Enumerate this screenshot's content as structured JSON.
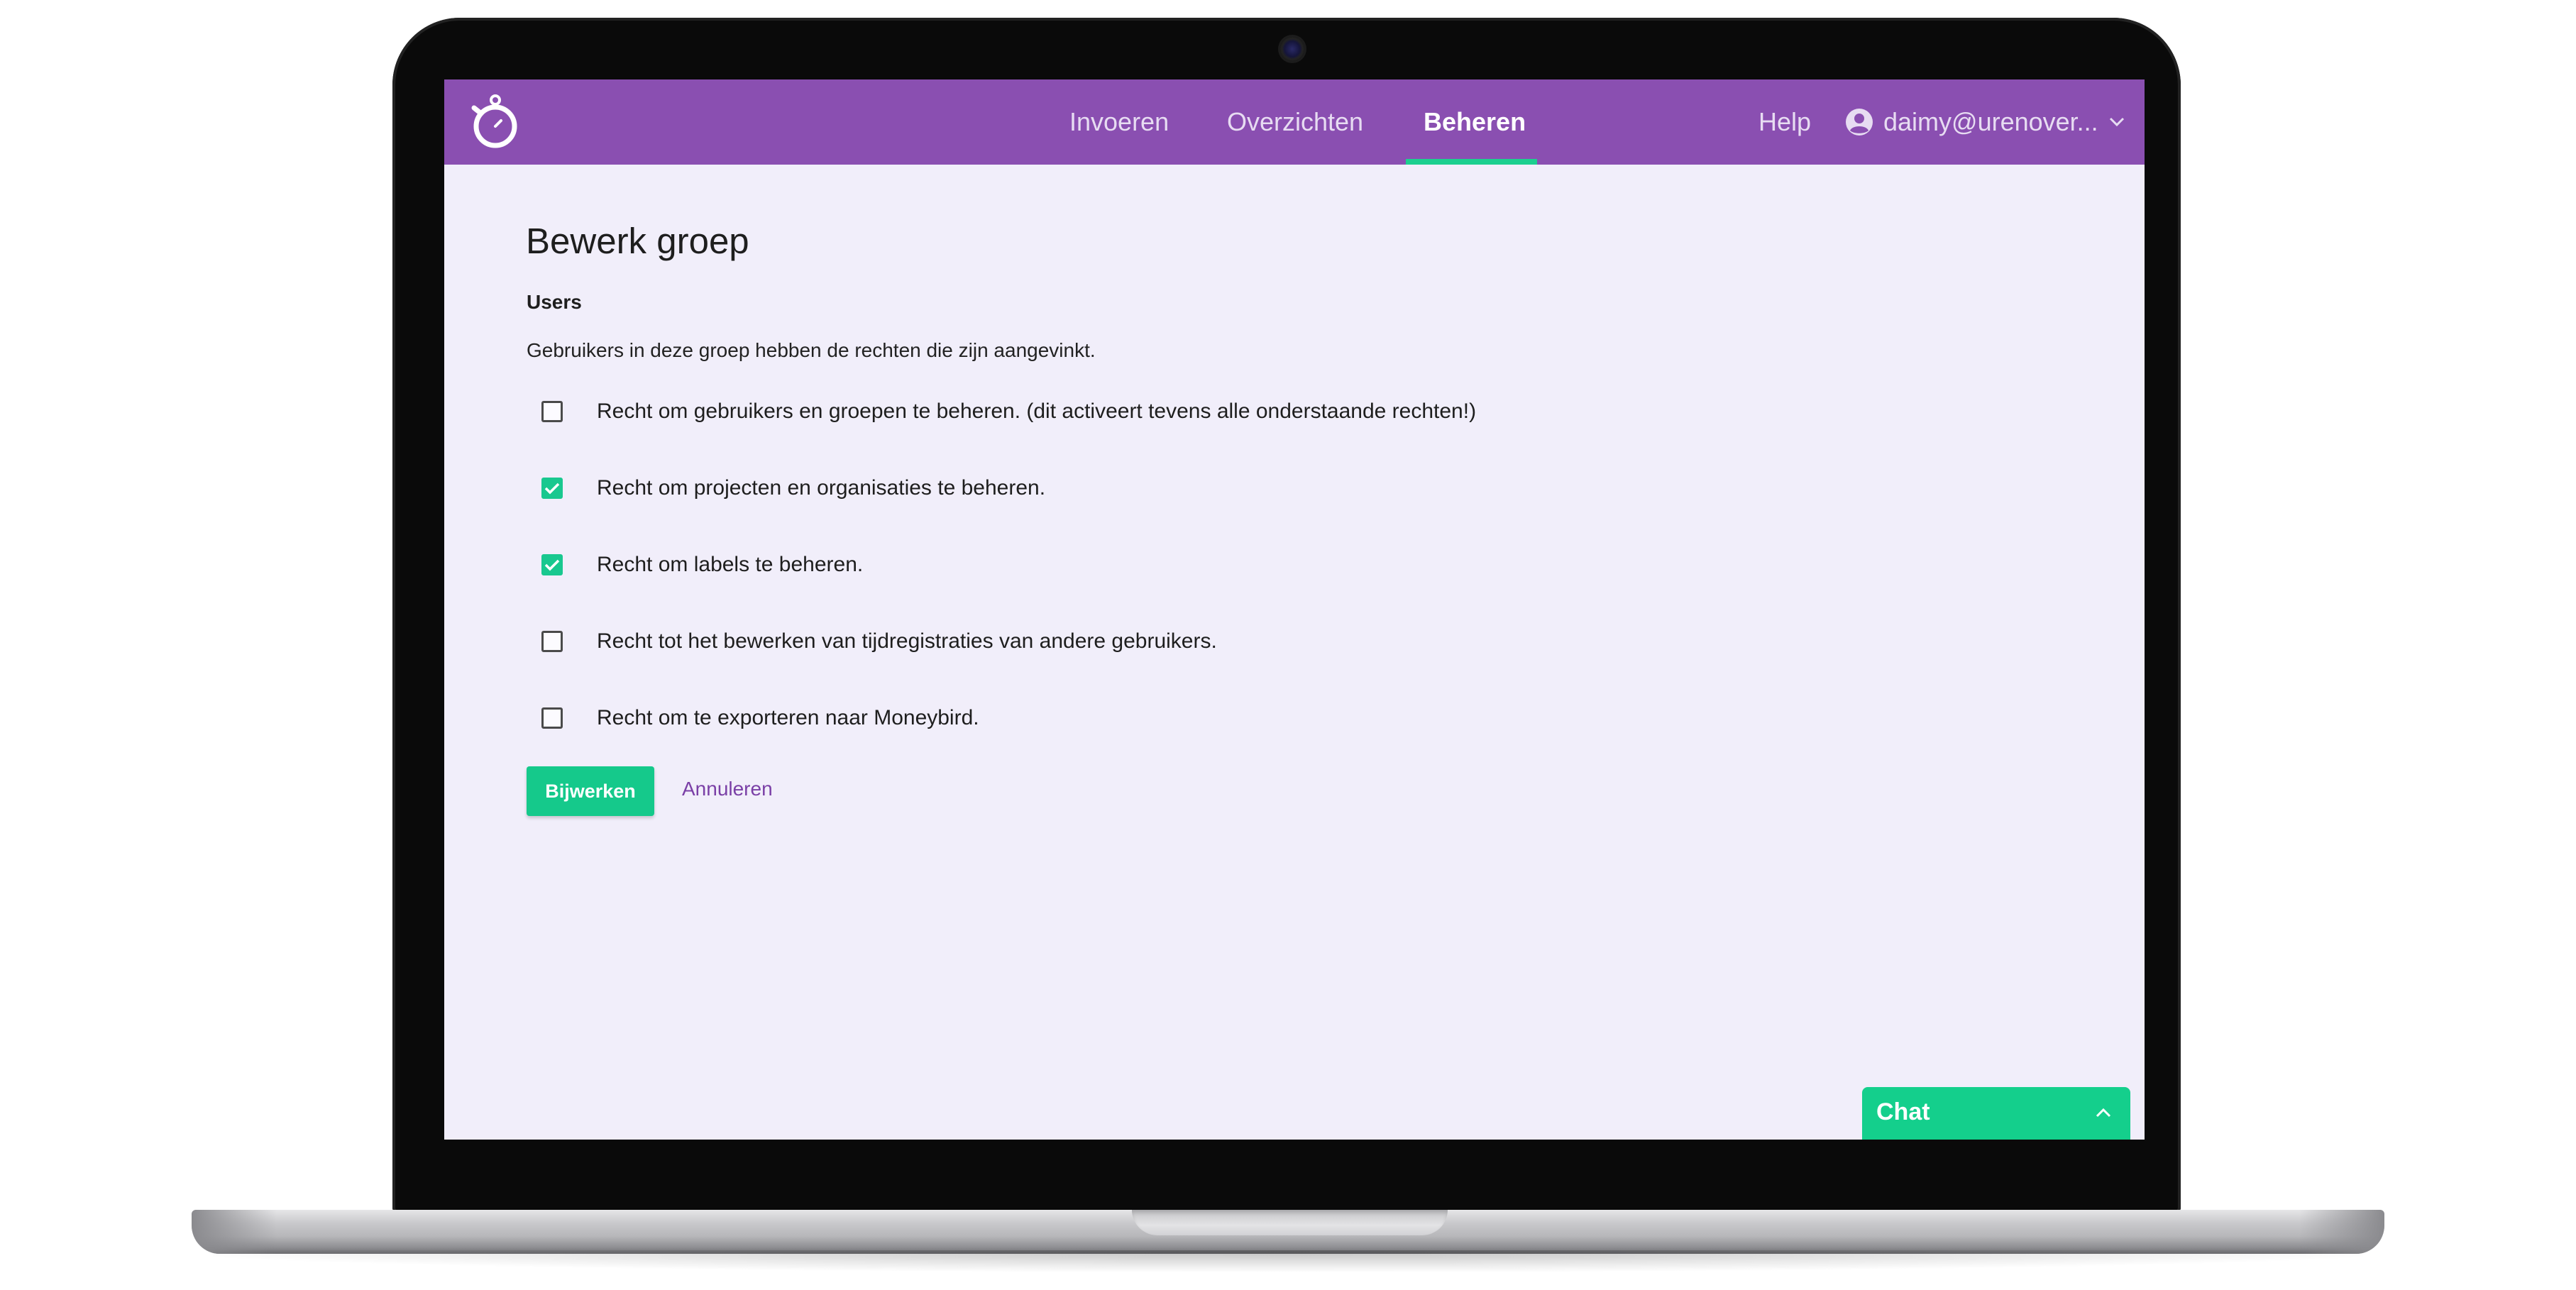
{
  "nav": {
    "items": [
      {
        "label": "Invoeren",
        "active": false
      },
      {
        "label": "Overzichten",
        "active": false
      },
      {
        "label": "Beheren",
        "active": true
      }
    ],
    "help": "Help",
    "user": "daimy@urenover..."
  },
  "page": {
    "title": "Bewerk groep",
    "group_name": "Users",
    "description": "Gebruikers in deze groep hebben de rechten die zijn aangevinkt."
  },
  "permissions": [
    {
      "label": "Recht om gebruikers en groepen te beheren. (dit activeert tevens alle onderstaande rechten!)",
      "checked": false
    },
    {
      "label": "Recht om projecten en organisaties te beheren.",
      "checked": true
    },
    {
      "label": "Recht om labels te beheren.",
      "checked": true
    },
    {
      "label": "Recht tot het bewerken van tijdregistraties van andere gebruikers.",
      "checked": false
    },
    {
      "label": "Recht om te exporteren naar Moneybird.",
      "checked": false
    }
  ],
  "actions": {
    "submit": "Bijwerken",
    "cancel": "Annuleren"
  },
  "chat": {
    "label": "Chat"
  },
  "colors": {
    "navbar": "#8a4fb1",
    "accent": "#15c98b",
    "link": "#7a3fa6",
    "background": "#f1eefa"
  },
  "icons": {
    "logo": "stopwatch-icon",
    "user": "user-circle-icon",
    "dropdown": "chevron-down-icon",
    "check": "check-icon",
    "chat_toggle": "chevron-up-icon"
  }
}
